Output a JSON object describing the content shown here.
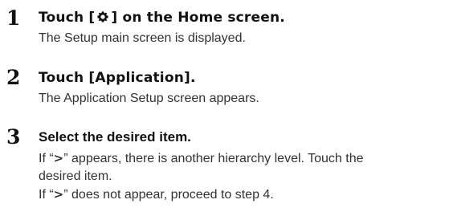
{
  "steps": [
    {
      "number": "1",
      "title_before": "Touch [",
      "icon": "gear-icon",
      "title_after": "] on the Home screen.",
      "body": [
        "The Setup main screen is displayed."
      ]
    },
    {
      "number": "2",
      "title": "Touch [Application].",
      "body": [
        "The Application Setup screen appears."
      ]
    },
    {
      "number": "3",
      "title": "Select the desired item.",
      "body_line1_before": "If “",
      "chevron": ">",
      "body_line1_after": "” appears, there is another hierarchy level. Touch the",
      "body_line2": "desired item.",
      "body_line3_before": "If “",
      "body_line3_after": "” does not appear, proceed to step 4."
    }
  ]
}
